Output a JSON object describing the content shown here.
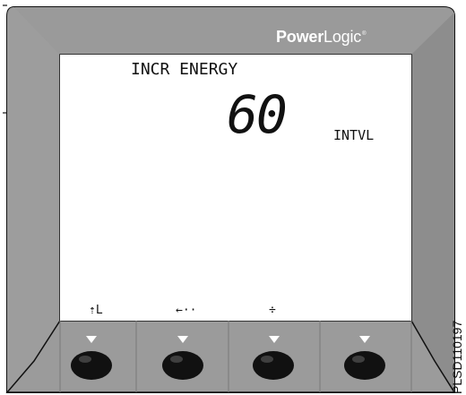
{
  "device": {
    "brand_part1": "Power",
    "brand_part2": "Logic",
    "brand_reg": "®"
  },
  "display": {
    "title": "INCR ENERGY",
    "value": "60",
    "unit": "INTVL"
  },
  "softkeys": {
    "key1_label": "⇡L",
    "key2_label": "←··",
    "key3_label": "÷",
    "key4_label": ""
  },
  "image_code": "PLSD110197",
  "colors": {
    "bezel_outer": "#8e8e8e",
    "bezel_inner": "#b8b8b8",
    "lcd_background": "#ffffff",
    "button_fill": "#111111"
  },
  "icons": {
    "arrow_indicators": "down-triangle-icon",
    "buttons": "round-button-icon"
  }
}
